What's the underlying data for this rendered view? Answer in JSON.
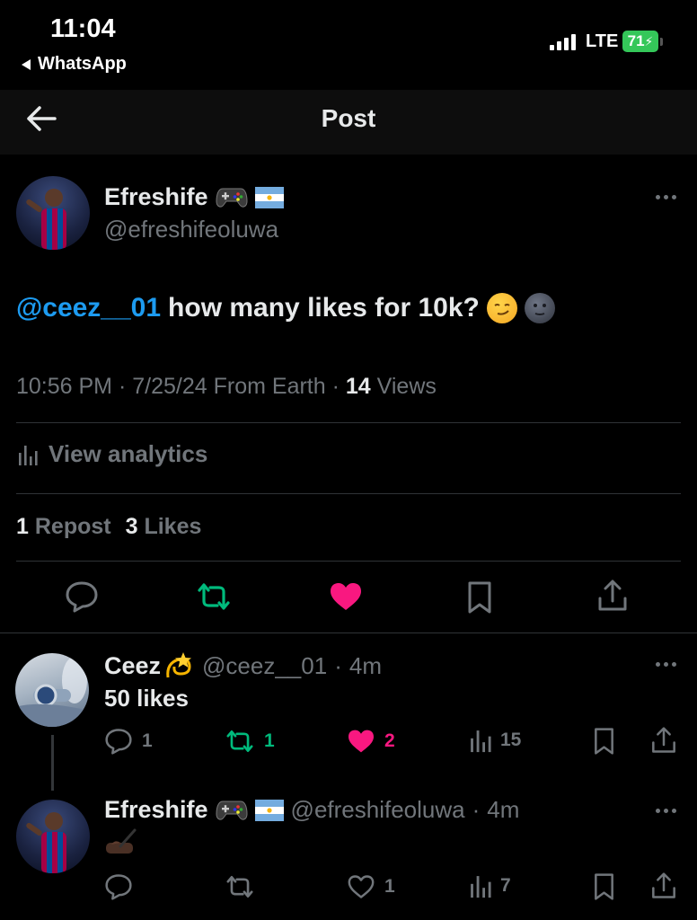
{
  "status_bar": {
    "time": "11:04",
    "back_app": "WhatsApp",
    "network": "LTE",
    "battery": "71"
  },
  "header": {
    "title": "Post"
  },
  "post": {
    "author_name": "Efreshife",
    "author_handle": "@efreshifeoluwa",
    "mention": "@ceez__01",
    "text": "how many likes for 10k?",
    "time": "10:56 PM",
    "date": "7/25/24",
    "location": "From Earth",
    "views_count": "14",
    "views_label": "Views",
    "analytics_label": "View analytics",
    "repost_count": "1",
    "repost_label": "Repost",
    "likes_count": "3",
    "likes_label": "Likes"
  },
  "replies": [
    {
      "name": "Ceez",
      "handle": "@ceez__01",
      "age": "4m",
      "text": "50 likes",
      "replies": "1",
      "reposts": "1",
      "likes": "2",
      "views": "15",
      "liked": true,
      "reposted": true
    },
    {
      "name": "Efreshife",
      "handle": "@efreshifeoluwa",
      "age": "4m",
      "text": "",
      "replies": "",
      "reposts": "",
      "likes": "1",
      "views": "7",
      "liked": false,
      "reposted": false
    }
  ],
  "colors": {
    "accent_blue": "#1d9bf0",
    "repost_green": "#00ba7c",
    "like_pink": "#f91880",
    "muted": "#71767b",
    "text": "#e7e9ea",
    "battery_green": "#34c759"
  }
}
